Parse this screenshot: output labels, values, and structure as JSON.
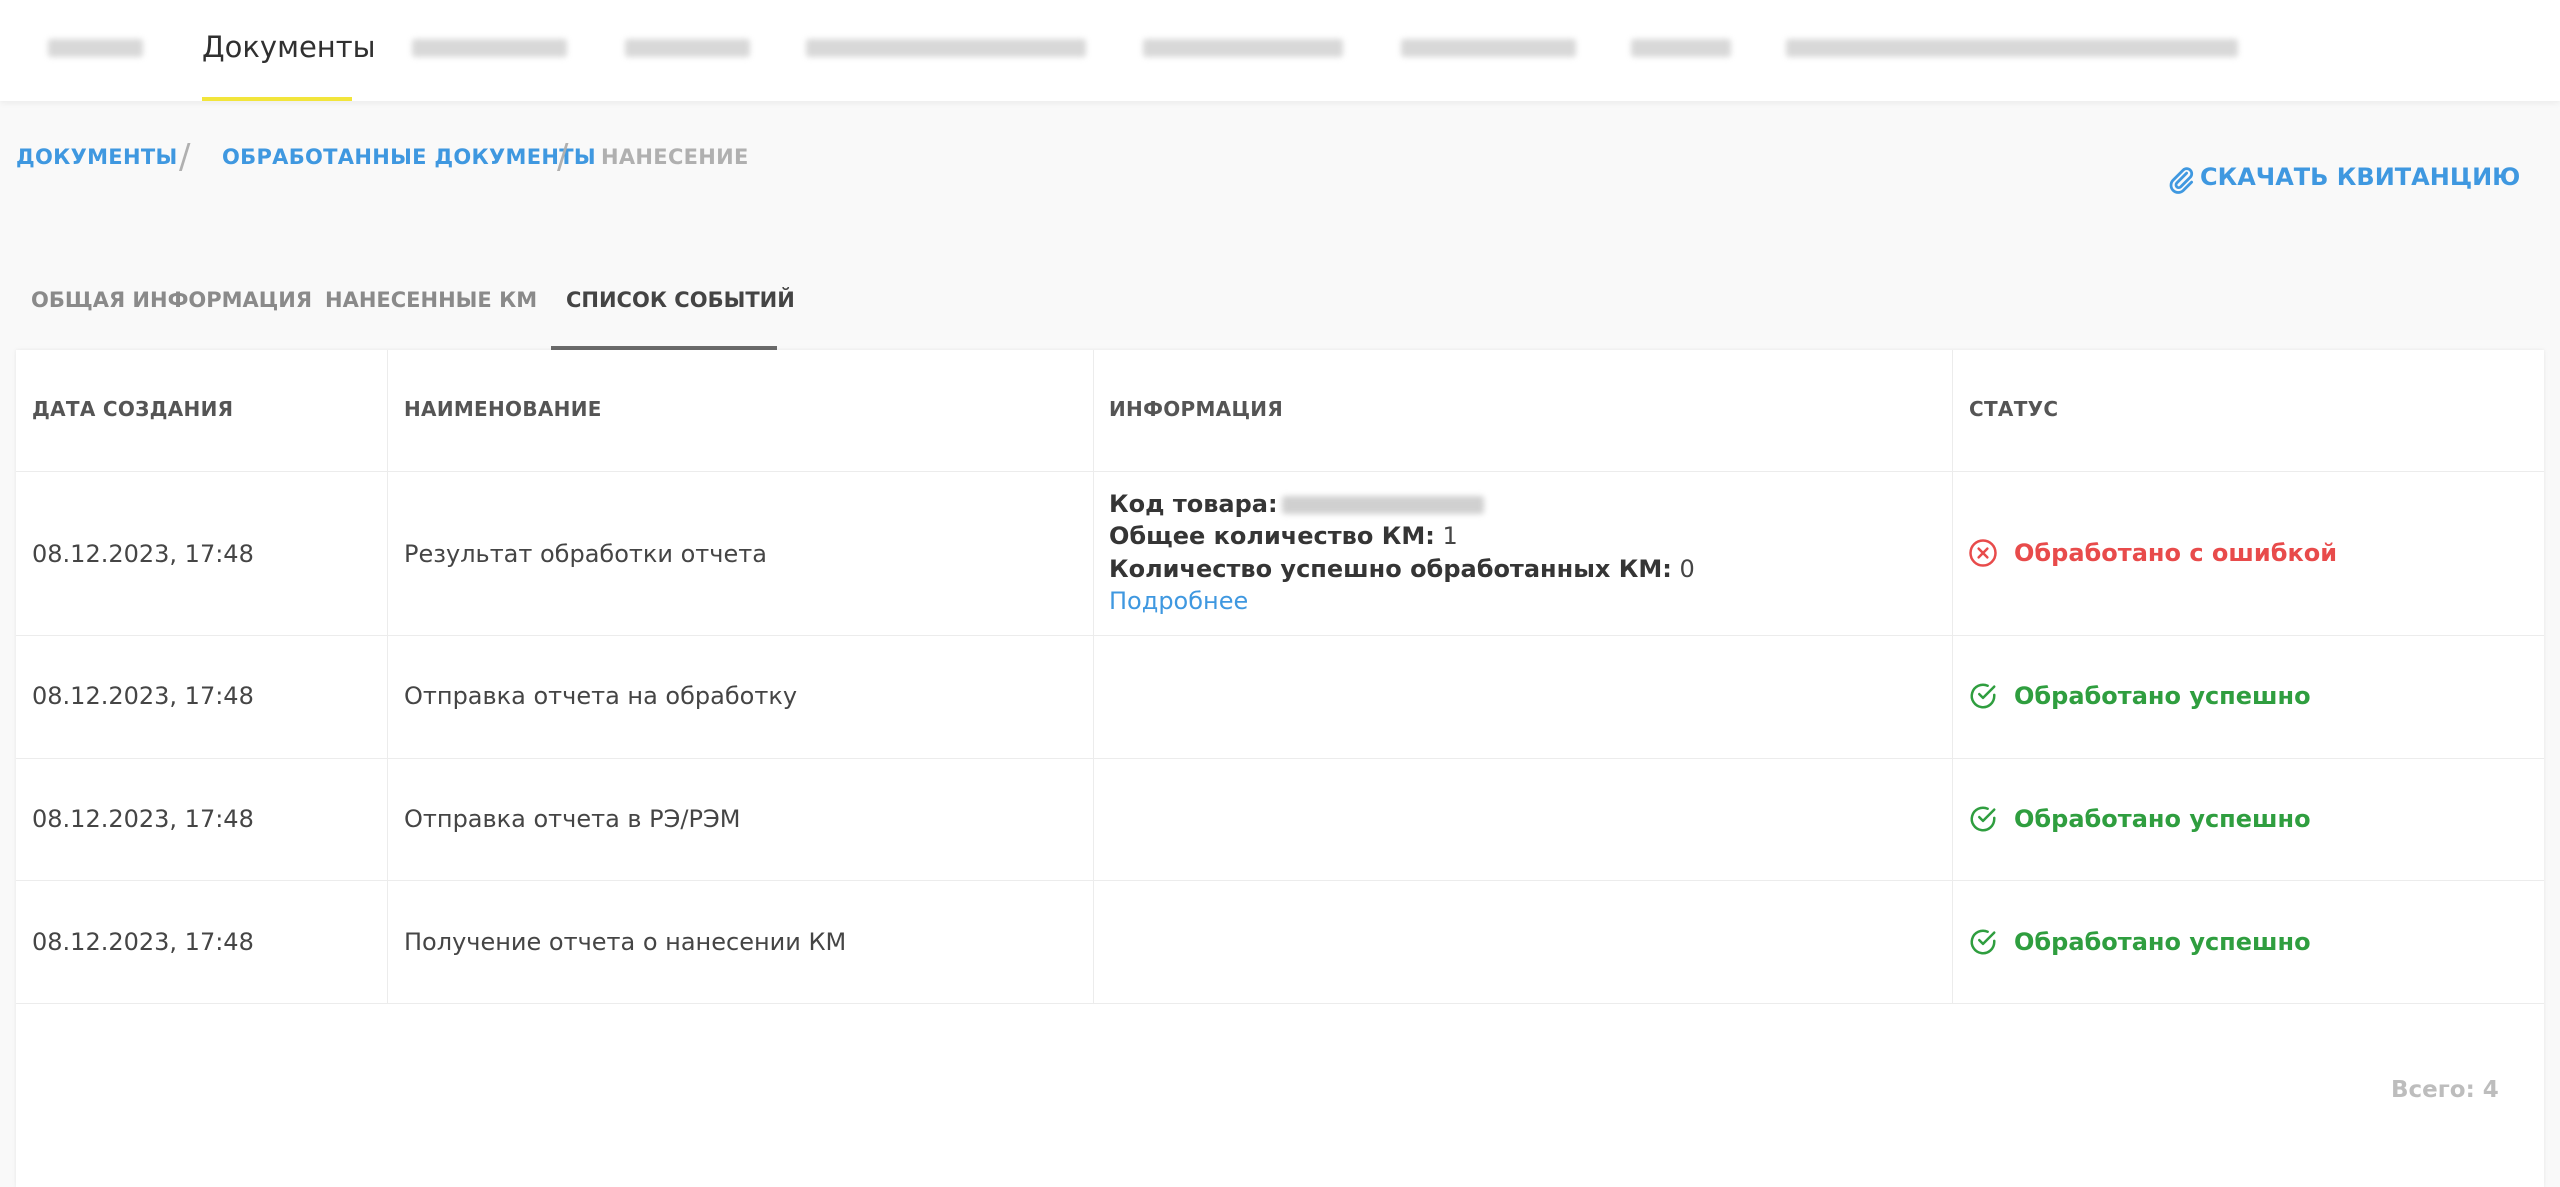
{
  "nav": {
    "active_label": "Документы"
  },
  "breadcrumb": {
    "items": [
      "ДОКУМЕНТЫ",
      "ОБРАБОТАННЫЕ ДОКУМЕНТЫ",
      "НАНЕСЕНИЕ"
    ],
    "separator": "/"
  },
  "download_label": "СКАЧАТЬ КВИТАНЦИЮ",
  "tabs": [
    "ОБЩАЯ ИНФОРМАЦИЯ",
    "НАНЕСЕННЫЕ КМ",
    "СПИСОК СОБЫТИЙ"
  ],
  "active_tab": "СПИСОК СОБЫТИЙ",
  "table": {
    "headers": [
      "ДАТА СОЗДАНИЯ",
      "НАИМЕНОВАНИЕ",
      "ИНФОРМАЦИЯ",
      "СТАТУС"
    ],
    "rows": [
      {
        "date": "08.12.2023, 17:48",
        "name": "Результат обработки отчета",
        "info": {
          "code_label": "Код товара:",
          "total_label": "Общее количество КМ:",
          "total_value": "1",
          "success_label": "Количество успешно обработанных КМ:",
          "success_value": "0",
          "more": "Подробнее"
        },
        "status": "Обработано с ошибкой",
        "status_type": "error",
        "status_icon": "error-circle-x-icon"
      },
      {
        "date": "08.12.2023, 17:48",
        "name": "Отправка отчета на обработку",
        "status": "Обработано успешно",
        "status_type": "success",
        "status_icon": "success-check-circle-icon"
      },
      {
        "date": "08.12.2023, 17:48",
        "name": "Отправка отчета в РЭ/РЭМ",
        "status": "Обработано успешно",
        "status_type": "success",
        "status_icon": "success-check-circle-icon"
      },
      {
        "date": "08.12.2023, 17:48",
        "name": "Получение отчета о нанесении КМ",
        "status": "Обработано успешно",
        "status_type": "success",
        "status_icon": "success-check-circle-icon"
      }
    ],
    "total": "Всего: 4"
  },
  "colors": {
    "link": "#3f98e0",
    "error": "#e84b4b",
    "success": "#2f9e3f",
    "nav_underline": "#f2e53b"
  }
}
